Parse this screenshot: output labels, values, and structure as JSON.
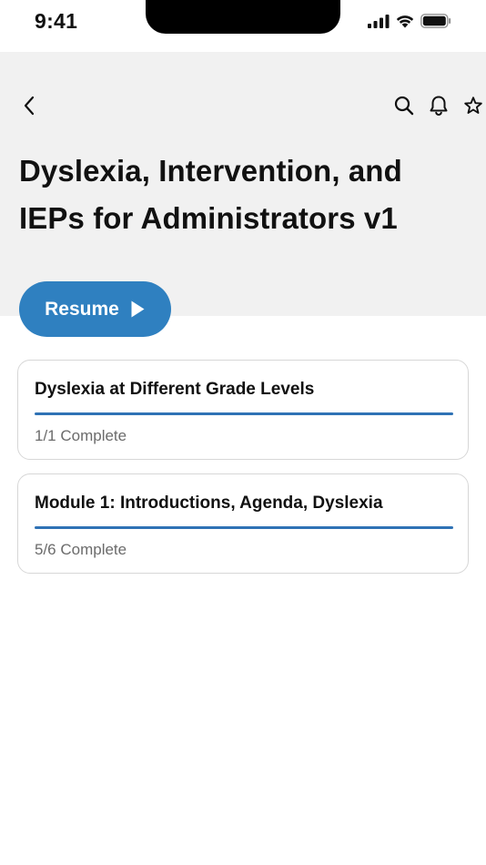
{
  "status_bar": {
    "time": "9:41"
  },
  "header": {
    "course_title": "Dyslexia, Intervention, and IEPs for Administrators v1",
    "resume_label": "Resume"
  },
  "modules": [
    {
      "title": "Dyslexia at Different Grade Levels",
      "status": "1/1 Complete",
      "progress": 1.0
    },
    {
      "title": "Module 1: Introductions, Agenda, Dyslexia",
      "status": "5/6 Complete",
      "progress": 1.0
    }
  ],
  "icons": {
    "back": "chevron-left-icon",
    "search": "search-icon",
    "notifications": "bell-icon",
    "favorite": "star-icon",
    "play": "play-icon"
  },
  "colors": {
    "accent": "#2f80c0",
    "progress": "#2f72b5",
    "hero_background": "#f1f1f1"
  }
}
